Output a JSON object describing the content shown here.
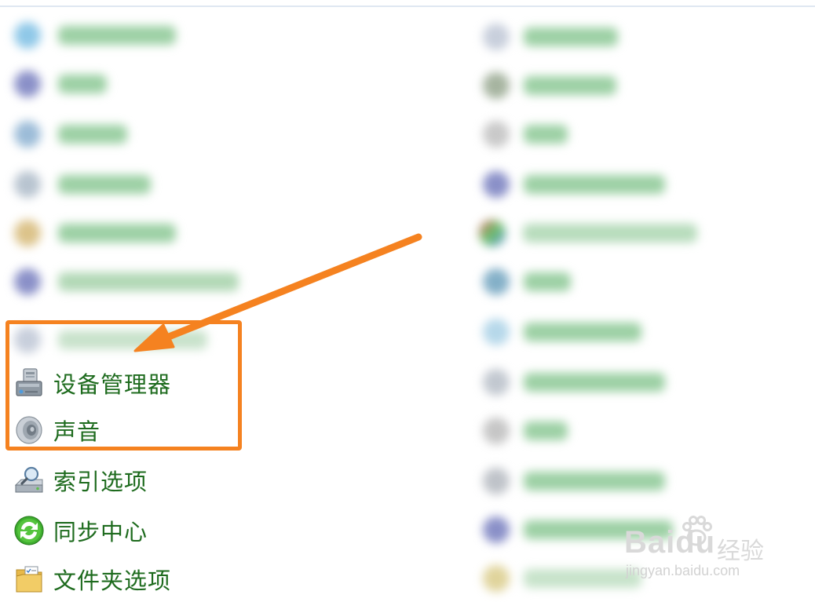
{
  "control_panel": {
    "left_items": [
      {
        "label": "设备管理器",
        "icon": "device-manager-icon"
      },
      {
        "label": "声音",
        "icon": "speaker-icon"
      },
      {
        "label": "索引选项",
        "icon": "indexing-options-icon"
      },
      {
        "label": "同步中心",
        "icon": "sync-center-icon"
      },
      {
        "label": "文件夹选项",
        "icon": "folder-options-icon"
      }
    ]
  },
  "annotation": {
    "highlight_color": "#f58220",
    "arrow_color": "#f58220",
    "highlighted_items": [
      "设备管理器",
      "声音"
    ]
  },
  "colors": {
    "label_green": "#1e6b1e"
  },
  "watermark": {
    "brand": "Bai",
    "brand_suffix": "du",
    "cn_text": "经验",
    "url": "jingyan.baidu.com"
  }
}
